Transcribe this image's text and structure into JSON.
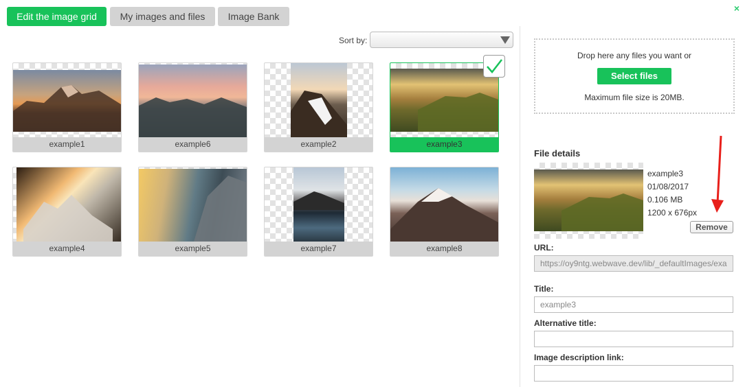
{
  "tabs": [
    {
      "label": "Edit the image grid",
      "active": true
    },
    {
      "label": "My images and files",
      "active": false
    },
    {
      "label": "Image Bank",
      "active": false
    }
  ],
  "close_icon": "×",
  "sort": {
    "label": "Sort by:",
    "value": ""
  },
  "images": [
    {
      "label": "example1"
    },
    {
      "label": "example6"
    },
    {
      "label": "example2"
    },
    {
      "label": "example3",
      "selected": true
    },
    {
      "label": "example4"
    },
    {
      "label": "example5"
    },
    {
      "label": "example7"
    },
    {
      "label": "example8"
    }
  ],
  "upload": {
    "drop_text": "Drop here any files you want or",
    "select_button": "Select files",
    "max_size": "Maximum file size is 20MB."
  },
  "file_details": {
    "title": "File details",
    "name": "example3",
    "date": "01/08/2017",
    "size": "0.106 MB",
    "dimensions": "1200 x 676px",
    "remove_button": "Remove"
  },
  "fields": {
    "url_label": "URL:",
    "url_value": "https://oy9ntg.webwave.dev/lib/_defaultImages/exa",
    "title_label": "Title:",
    "title_placeholder": "example3",
    "alt_label": "Alternative title:",
    "alt_value": "",
    "link_label": "Image description link:",
    "link_value": ""
  },
  "colors": {
    "accent": "#18c25a",
    "annotation": "#e8201b"
  }
}
